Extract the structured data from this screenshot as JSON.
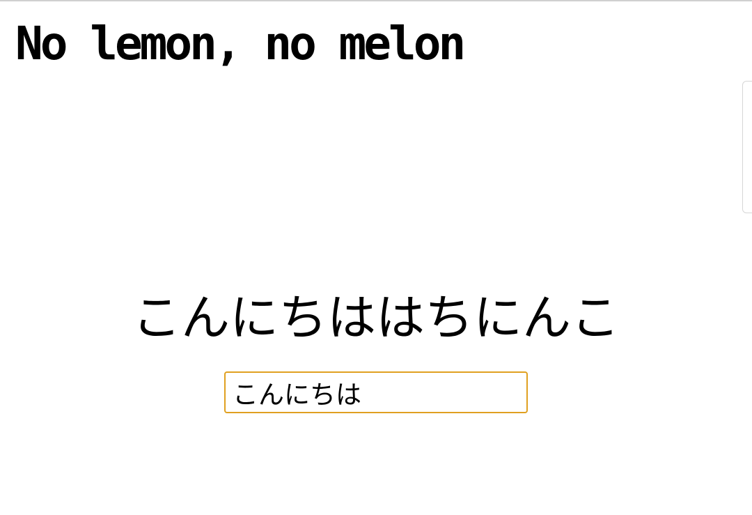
{
  "header": {
    "title": "No lemon, no melon"
  },
  "main": {
    "palindrome": "こんにちははちにんこ",
    "input": {
      "value": "こんにちは",
      "placeholder": ""
    }
  },
  "colors": {
    "input_focus_border": "#e0a020",
    "text": "#000000",
    "background": "#ffffff"
  }
}
